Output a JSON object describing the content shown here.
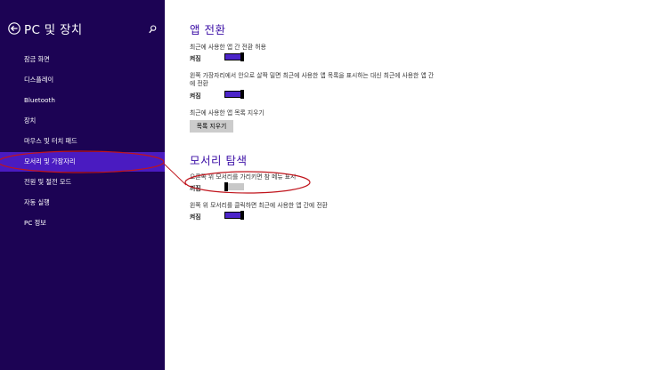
{
  "sidebar": {
    "title": "PC 및 장치",
    "back_icon": "back-arrow-icon",
    "search_icon": "search-icon",
    "items": [
      {
        "label": "잠금 화면"
      },
      {
        "label": "디스플레이"
      },
      {
        "label": "Bluetooth"
      },
      {
        "label": "장치"
      },
      {
        "label": "마우스 및 터치 패드"
      },
      {
        "label": "모서리 및 가장자리"
      },
      {
        "label": "전원 및 절전 모드"
      },
      {
        "label": "자동 실행"
      },
      {
        "label": "PC 정보"
      }
    ]
  },
  "app_switching": {
    "title": "앱 전환",
    "setting1": {
      "label": "최근에 사용한 앱 간 전환 허용",
      "state": "켜짐",
      "on": true
    },
    "setting2": {
      "label": "왼쪽 가장자리에서 안으로 살짝 밀면 최근에 사용한 앱 목록을 표시하는 대신 최근에 사용한 앱 간에 전환",
      "state": "켜짐",
      "on": true
    },
    "clear_label": "최근에 사용한 앱 목록 지우기",
    "clear_button": "목록 지우기"
  },
  "corner_navigation": {
    "title": "모서리 탐색",
    "setting1": {
      "label": "오른쪽 위 모서리를 가리키면 참 메뉴 표시",
      "state": "꺼짐",
      "on": false
    },
    "setting2": {
      "label": "왼쪽 위 모서리를 클릭하면 최근에 사용한 앱 간에 전환",
      "state": "켜짐",
      "on": true
    }
  },
  "colors": {
    "sidebar_bg": "#1c0354",
    "selected_bg": "#4a1bc1",
    "accent": "#3b0ea6",
    "annotation": "#c0141c"
  }
}
